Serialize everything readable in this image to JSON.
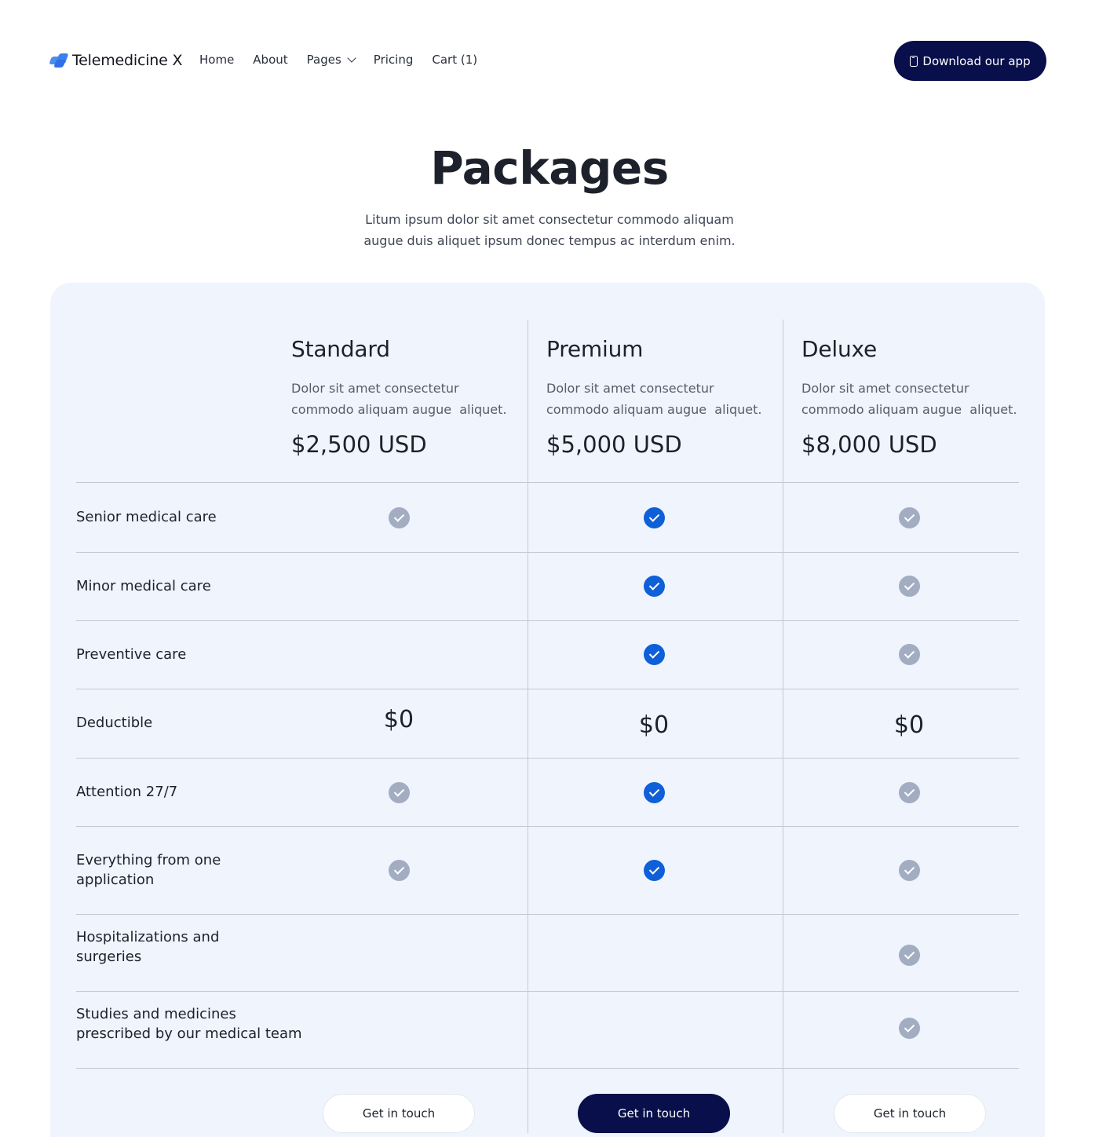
{
  "nav": {
    "brand": "Telemedicine X",
    "links": [
      "Home",
      "About",
      "Pages",
      "Pricing",
      "Cart (1)"
    ],
    "download_label": "Download our app"
  },
  "hero": {
    "title": "Packages",
    "subtitle_line1": "Litum ipsum dolor sit amet consectetur commodo aliquam",
    "subtitle_line2": "augue duis aliquet ipsum donec tempus ac interdum enim."
  },
  "plans": [
    {
      "name": "Standard",
      "desc_line1": "Dolor sit amet consectetur",
      "desc_line2": "commodo aliquam augue  aliquet.",
      "price": "$2,500 USD",
      "cta": "Get in touch"
    },
    {
      "name": "Premium",
      "desc_line1": "Dolor sit amet consectetur",
      "desc_line2": "commodo aliquam augue  aliquet.",
      "price": "$5,000 USD",
      "cta": "Get in touch"
    },
    {
      "name": "Deluxe",
      "desc_line1": "Dolor sit amet consectetur",
      "desc_line2": "commodo aliquam augue  aliquet.",
      "price": "$8,000 USD",
      "cta": "Get in touch"
    }
  ],
  "features": [
    {
      "label_line1": "Senior medical care",
      "label_line2": ""
    },
    {
      "label_line1": "Minor medical care",
      "label_line2": ""
    },
    {
      "label_line1": "Preventive care",
      "label_line2": ""
    },
    {
      "label_line1": "Deductible",
      "label_line2": ""
    },
    {
      "label_line1": "Attention 27/7",
      "label_line2": ""
    },
    {
      "label_line1": "Everything from one",
      "label_line2": "application"
    },
    {
      "label_line1": "Hospitalizations and",
      "label_line2": "surgeries"
    },
    {
      "label_line1": "Studies and medicines",
      "label_line2": "prescribed by our medical team"
    }
  ],
  "deductibles": [
    "$0",
    "$0",
    "$0"
  ],
  "icons": {
    "check_gray": "check-circle-icon",
    "check_blue": "check-circle-icon",
    "logo": "telemedicine-logo-icon",
    "phone": "phone-icon",
    "chevron": "chevron-down-icon"
  },
  "colors": {
    "navy": "#080f4a",
    "accent_blue": "#0f5fd9",
    "check_gray": "#a3adc1",
    "card_bg": "#eff4fd"
  }
}
